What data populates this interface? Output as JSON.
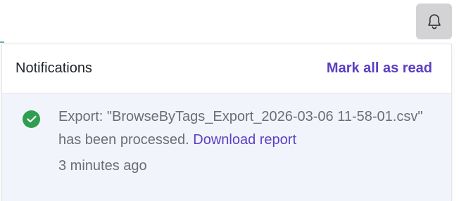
{
  "notifications": {
    "bell_icon": "bell-icon",
    "title": "Notifications",
    "mark_all_label": "Mark all as read",
    "items": [
      {
        "status_icon": "check-circle-icon",
        "message": "Export: \"BrowseByTags_Export_2026-03-06 11-58-01.csv\" has been processed.",
        "link_label": "Download report",
        "time": "3 minutes ago"
      }
    ]
  },
  "colors": {
    "accent": "#5b3fc2",
    "success": "#2f9e4f",
    "unread_bg": "#f1f4fb"
  }
}
